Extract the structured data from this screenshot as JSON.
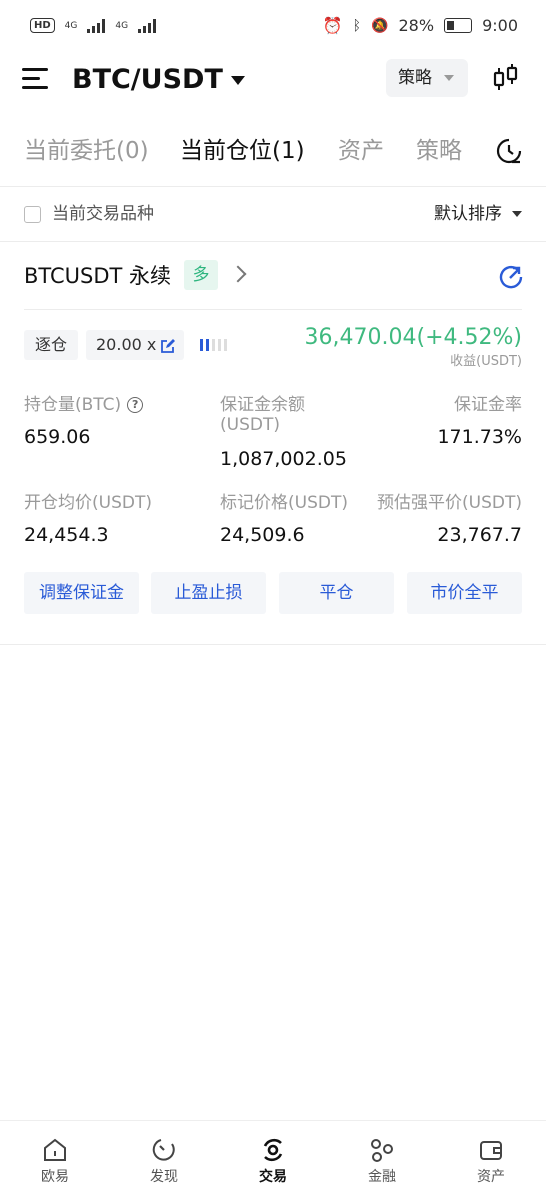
{
  "status_bar": {
    "hd_label": "HD",
    "network_1": "4G",
    "network_2": "4G",
    "battery": "28%",
    "time": "9:00"
  },
  "header": {
    "pair": "BTC/USDT",
    "strategy_label": "策略"
  },
  "tabs": [
    {
      "label": "当前委托(0)",
      "active": false
    },
    {
      "label": "当前仓位(1)",
      "active": true
    },
    {
      "label": "资产",
      "active": false
    },
    {
      "label": "策略",
      "active": false
    }
  ],
  "filter": {
    "current_symbol_label": "当前交易品种",
    "sort_label": "默认排序"
  },
  "position": {
    "symbol": "BTCUSDT 永续",
    "side": "多",
    "margin_mode": "逐仓",
    "leverage": "20.00 x",
    "pnl": "36,470.04(+4.52%)",
    "pnl_label": "收益(USDT)",
    "size_label": "持仓量(BTC)",
    "size": "659.06",
    "margin_balance_label_1": "保证金余额",
    "margin_balance_label_2": "(USDT)",
    "margin_balance": "1,087,002.05",
    "margin_ratio_label": "保证金率",
    "margin_ratio": "171.73%",
    "entry_price_label": "开仓均价(USDT)",
    "entry_price": "24,454.3",
    "mark_price_label": "标记价格(USDT)",
    "mark_price": "24,509.6",
    "liq_price_label": "预估强平价(USDT)",
    "liq_price": "23,767.7",
    "actions": {
      "adjust_margin": "调整保证金",
      "tp_sl": "止盈止损",
      "close": "平仓",
      "market_close_all": "市价全平"
    },
    "colors": {
      "profit_green": "#3fb97f",
      "accent_blue": "#2a5bd7"
    }
  },
  "bottom_nav": [
    {
      "label": "欧易",
      "icon": "home-icon",
      "active": false
    },
    {
      "label": "发现",
      "icon": "discover-icon",
      "active": false
    },
    {
      "label": "交易",
      "icon": "trade-icon",
      "active": true
    },
    {
      "label": "金融",
      "icon": "finance-icon",
      "active": false
    },
    {
      "label": "资产",
      "icon": "wallet-icon",
      "active": false
    }
  ]
}
